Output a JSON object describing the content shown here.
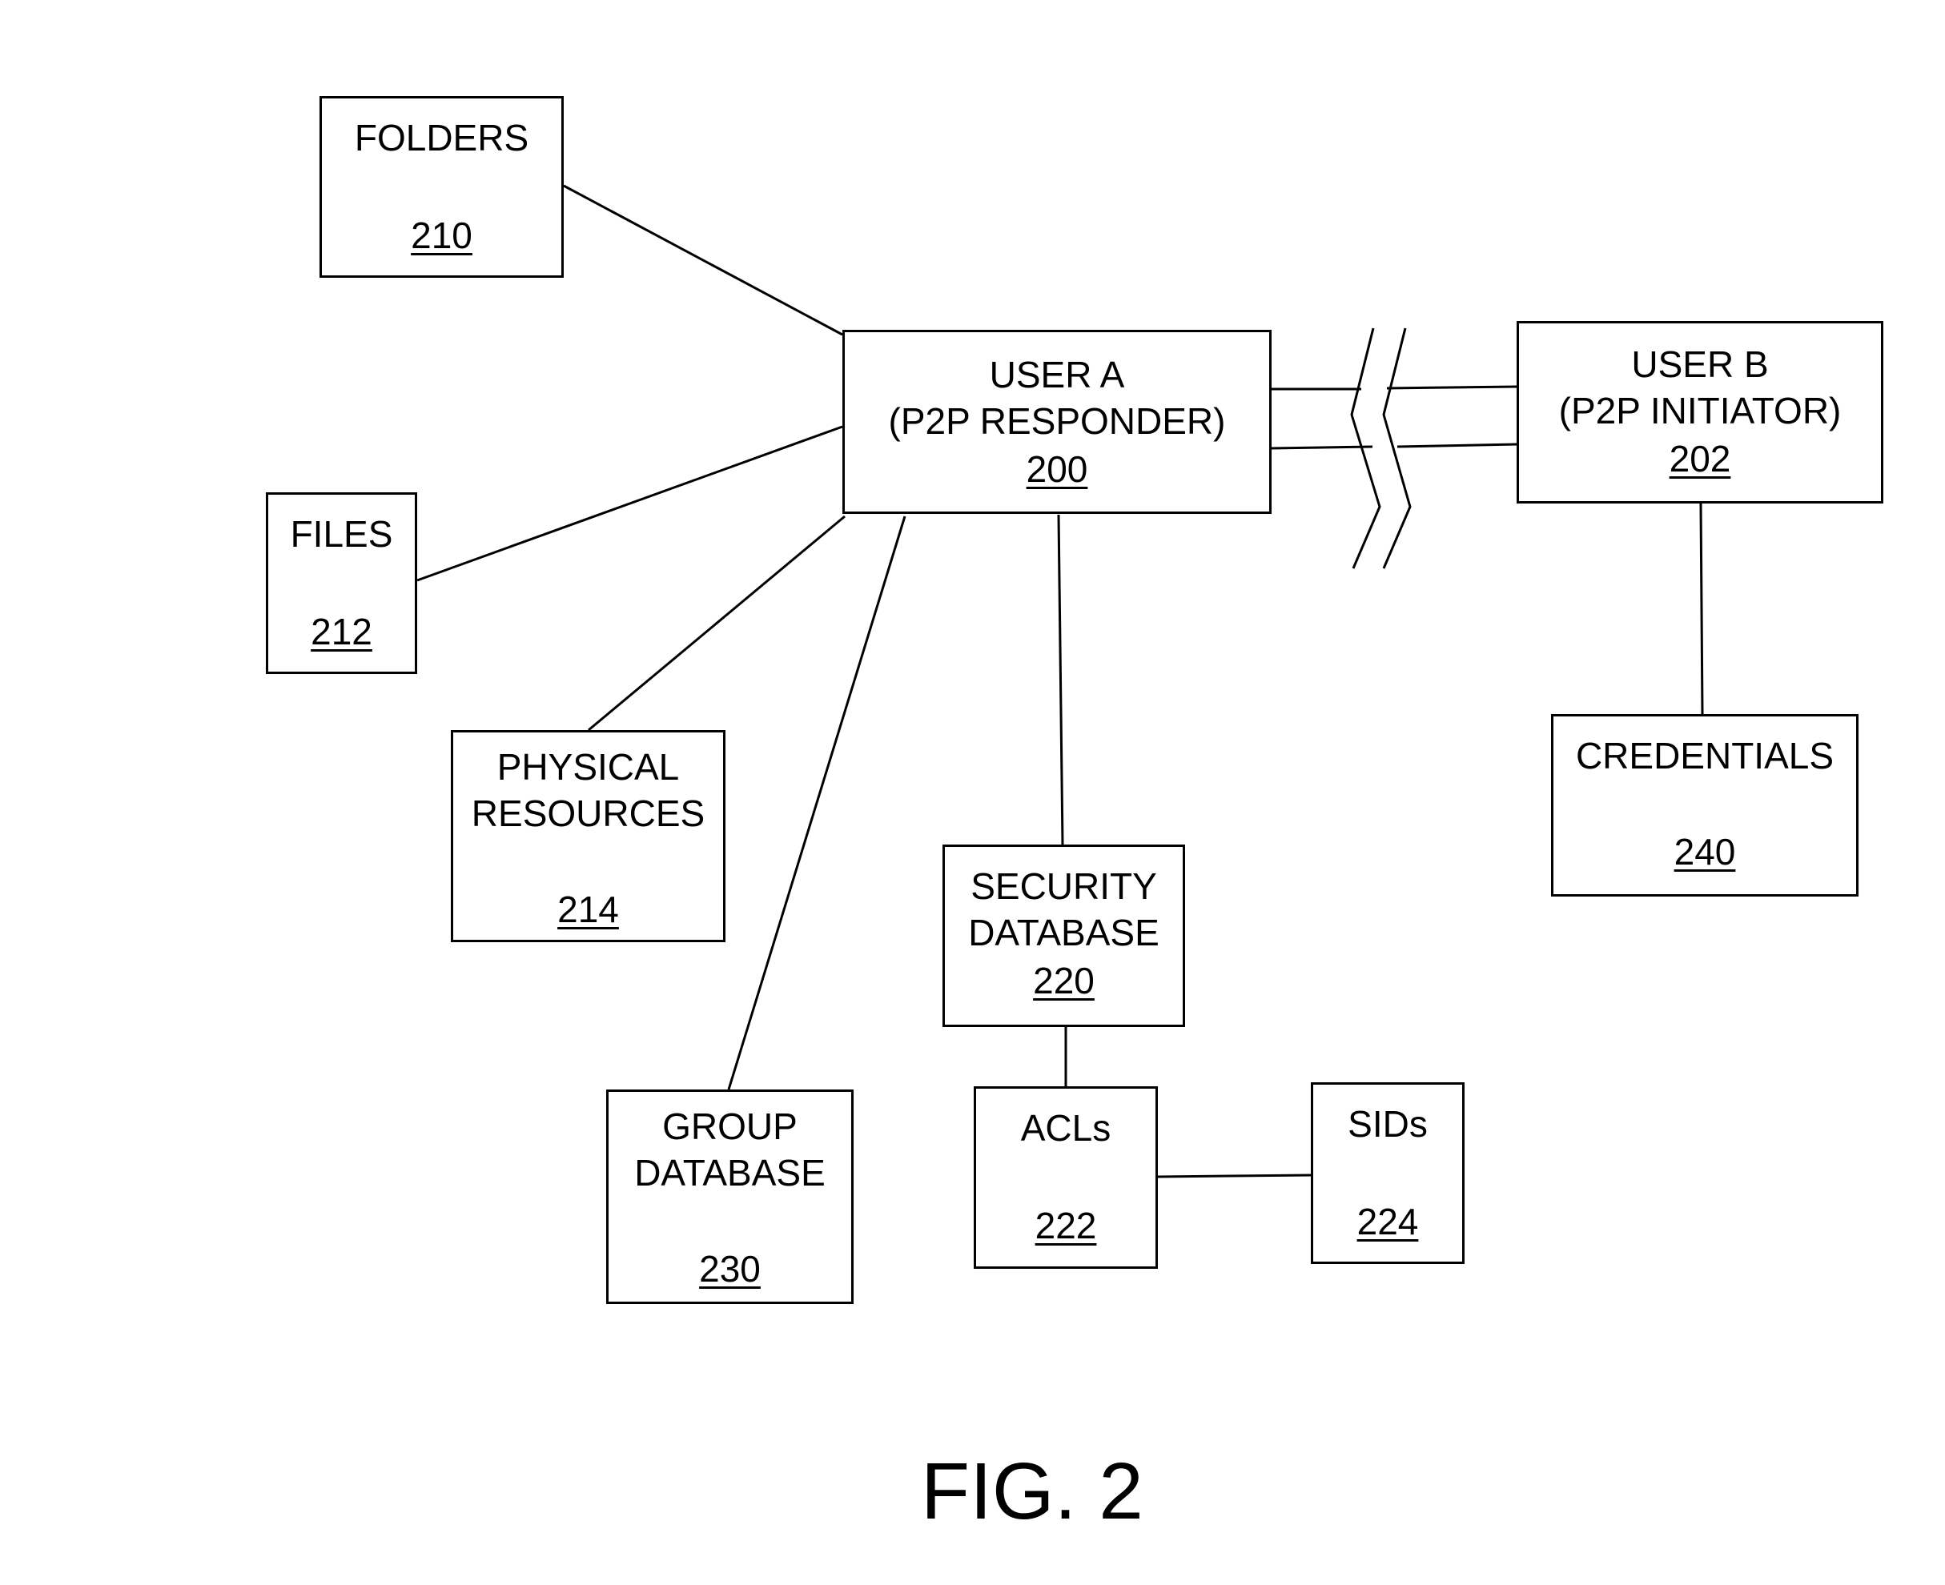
{
  "figure": {
    "caption": "FIG. 2"
  },
  "nodes": {
    "folders": {
      "label": "FOLDERS",
      "ref": "210"
    },
    "files": {
      "label": "FILES",
      "ref": "212"
    },
    "physical": {
      "label": "PHYSICAL\nRESOURCES",
      "ref": "214"
    },
    "user_a": {
      "label": "USER  A\n(P2P RESPONDER)",
      "ref": "200"
    },
    "user_b": {
      "label": "USER  B\n(P2P INITIATOR)",
      "ref": "202"
    },
    "credentials": {
      "label": "CREDENTIALS",
      "ref": "240"
    },
    "security_db": {
      "label": "SECURITY\nDATABASE",
      "ref": "220"
    },
    "group_db": {
      "label": "GROUP\nDATABASE",
      "ref": "230"
    },
    "acls": {
      "label": "ACLs",
      "ref": "222"
    },
    "sids": {
      "label": "SIDs",
      "ref": "224"
    }
  },
  "edges": [
    [
      "user_a",
      "folders"
    ],
    [
      "user_a",
      "files"
    ],
    [
      "user_a",
      "physical"
    ],
    [
      "user_a",
      "group_db"
    ],
    [
      "user_a",
      "security_db"
    ],
    [
      "user_a",
      "user_b",
      "network-link-broken"
    ],
    [
      "user_b",
      "credentials"
    ],
    [
      "security_db",
      "acls"
    ],
    [
      "acls",
      "sids"
    ]
  ]
}
